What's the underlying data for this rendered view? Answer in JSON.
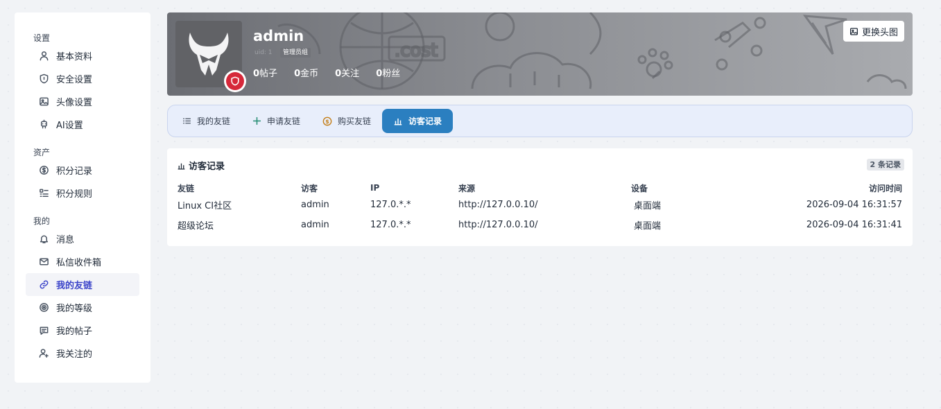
{
  "sidebar": {
    "groups": [
      {
        "heading": "设置",
        "items": [
          {
            "label": "基本资料",
            "icon": "user-icon"
          },
          {
            "label": "安全设置",
            "icon": "shield-icon"
          },
          {
            "label": "头像设置",
            "icon": "image-icon"
          },
          {
            "label": "AI设置",
            "icon": "robot-icon"
          }
        ]
      },
      {
        "heading": "资产",
        "items": [
          {
            "label": "积分记录",
            "icon": "coin-icon"
          },
          {
            "label": "积分规则",
            "icon": "list-icon"
          }
        ]
      },
      {
        "heading": "我的",
        "items": [
          {
            "label": "消息",
            "icon": "bell-icon"
          },
          {
            "label": "私信收件箱",
            "icon": "mail-icon"
          },
          {
            "label": "我的友链",
            "icon": "link-icon",
            "active": true
          },
          {
            "label": "我的等级",
            "icon": "level-icon"
          },
          {
            "label": "我的帖子",
            "icon": "comment-icon"
          },
          {
            "label": "我关注的",
            "icon": "user-plus-icon"
          }
        ]
      }
    ]
  },
  "profile": {
    "username": "admin",
    "uid": "uid: 1",
    "role": "管理员组",
    "stats": [
      {
        "value": "0",
        "label": "帖子"
      },
      {
        "value": "0",
        "label": "金币"
      },
      {
        "value": "0",
        "label": "关注"
      },
      {
        "value": "0",
        "label": "粉丝"
      }
    ],
    "change_avatar_label": "更换头图",
    "banner_text": ".cost"
  },
  "tabs": [
    {
      "label": "我的友链",
      "icon": "list-icon"
    },
    {
      "label": "申请友链",
      "icon": "plus-icon"
    },
    {
      "label": "购买友链",
      "icon": "dollar-icon"
    },
    {
      "label": "访客记录",
      "icon": "bar-chart-icon",
      "active": true
    }
  ],
  "records": {
    "title": "访客记录",
    "count_label": "2 条记录",
    "columns": [
      "友链",
      "访客",
      "IP",
      "来源",
      "设备",
      "访问时间"
    ],
    "rows": [
      [
        "Linux CI社区",
        "admin",
        "127.0.*.*",
        "http://127.0.0.10/",
        "桌面端",
        "2026-09-04 16:31:57"
      ],
      [
        "超级论坛",
        "admin",
        "127.0.*.*",
        "http://127.0.0.10/",
        "桌面端",
        "2026-09-04 16:31:41"
      ]
    ]
  },
  "colors": {
    "accent": "#2b7fc0",
    "sidebar_active": "#3b44c9",
    "badge_red": "#d6283a"
  }
}
